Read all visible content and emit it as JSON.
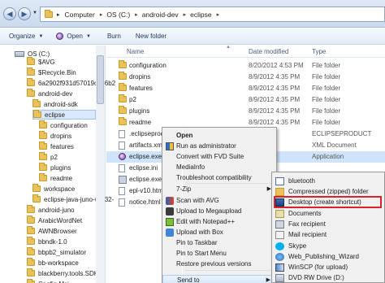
{
  "address": {
    "crumbs": [
      "Computer",
      "OS (C:)",
      "android-dev",
      "eclipse"
    ]
  },
  "toolbar": {
    "organize": "Organize",
    "open": "Open",
    "burn": "Burn",
    "new_folder": "New folder"
  },
  "columns": {
    "name": "Name",
    "date": "Date modified",
    "type": "Type"
  },
  "nav": {
    "items": [
      {
        "label": "OS (C:)",
        "kind": "drive"
      },
      {
        "label": "$AVG",
        "kind": "folder"
      },
      {
        "label": "$Recycle.Bin",
        "kind": "folder"
      },
      {
        "label": "6a2902f931d57019c886b2",
        "kind": "folder"
      },
      {
        "label": "android-dev",
        "kind": "folder"
      },
      {
        "label": "android-sdk",
        "kind": "folder"
      },
      {
        "label": "eclipse",
        "kind": "folder",
        "selected": true
      },
      {
        "label": "configuration",
        "kind": "folder"
      },
      {
        "label": "dropins",
        "kind": "folder"
      },
      {
        "label": "features",
        "kind": "folder"
      },
      {
        "label": "p2",
        "kind": "folder"
      },
      {
        "label": "plugins",
        "kind": "folder"
      },
      {
        "label": "readme",
        "kind": "folder"
      },
      {
        "label": "workspace",
        "kind": "folder"
      },
      {
        "label": "eclipse-java-juno-win32-",
        "kind": "folder"
      },
      {
        "label": "android-juno",
        "kind": "folder"
      },
      {
        "label": "ArabicWordNet",
        "kind": "folder"
      },
      {
        "label": "AWNBrowser",
        "kind": "folder"
      },
      {
        "label": "bbndk-1.0",
        "kind": "folder"
      },
      {
        "label": "bbpb2_simulator",
        "kind": "folder"
      },
      {
        "label": "bb-workspace",
        "kind": "folder"
      },
      {
        "label": "blackberry.tools.SDK",
        "kind": "folder"
      },
      {
        "label": "Config.Msi",
        "kind": "folder"
      }
    ]
  },
  "files": [
    {
      "name": "configuration",
      "date": "8/20/2012 4:53 PM",
      "type": "File folder",
      "icon": "folder"
    },
    {
      "name": "dropins",
      "date": "8/9/2012 4:35 PM",
      "type": "File folder",
      "icon": "folder"
    },
    {
      "name": "features",
      "date": "8/9/2012 4:35 PM",
      "type": "File folder",
      "icon": "folder"
    },
    {
      "name": "p2",
      "date": "8/9/2012 4:35 PM",
      "type": "File folder",
      "icon": "folder"
    },
    {
      "name": "plugins",
      "date": "8/9/2012 4:35 PM",
      "type": "File folder",
      "icon": "folder"
    },
    {
      "name": "readme",
      "date": "8/9/2012 4:35 PM",
      "type": "File folder",
      "icon": "folder"
    },
    {
      "name": ".eclipseprod",
      "date": "4:35 PM",
      "type": "ECLIPSEPRODUCT",
      "icon": "file"
    },
    {
      "name": "artifacts.xml",
      "date": "4:35 PM",
      "type": "XML Document",
      "icon": "file"
    },
    {
      "name": "eclipse.exe",
      "date": "4:35 PM",
      "type": "Application",
      "icon": "app",
      "selected": true
    },
    {
      "name": "eclipse.ini",
      "date": "",
      "type": "",
      "icon": "file"
    },
    {
      "name": "eclipse.exe",
      "date": "",
      "type": "",
      "icon": "sys"
    },
    {
      "name": "epl-v10.htm",
      "date": "",
      "type": "",
      "icon": "file"
    },
    {
      "name": "notice.html",
      "date": "",
      "type": "",
      "icon": "file"
    }
  ],
  "context_menu": {
    "items": [
      {
        "label": "Open",
        "bold": true,
        "icon": ""
      },
      {
        "label": "Run as administrator",
        "icon": "shield-icon"
      },
      {
        "label": "Convert with FVD Suite",
        "icon": ""
      },
      {
        "label": "MediaInfo",
        "icon": ""
      },
      {
        "label": "Troubleshoot compatibility",
        "icon": ""
      },
      {
        "label": "7-Zip",
        "icon": "",
        "submenu": true
      },
      {
        "label": "Scan with AVG",
        "icon": "avg-icon"
      },
      {
        "label": "Upload to Megaupload",
        "icon": "megaupload-icon"
      },
      {
        "label": "Edit with Notepad++",
        "icon": "notepad-icon"
      },
      {
        "label": "Upload with Box",
        "icon": "box-icon"
      },
      {
        "label": "Pin to Taskbar",
        "icon": ""
      },
      {
        "label": "Pin to Start Menu",
        "icon": ""
      },
      {
        "label": "Restore previous versions",
        "icon": ""
      },
      {
        "label": "Send to",
        "icon": "",
        "submenu": true
      }
    ]
  },
  "send_to": {
    "items": [
      {
        "label": "bluetooth",
        "icon": "bluetooth-icon"
      },
      {
        "label": "Compressed (zipped) folder",
        "icon": "zip-icon"
      },
      {
        "label": "Desktop (create shortcut)",
        "icon": "desktop-icon",
        "highlighted": true
      },
      {
        "label": "Documents",
        "icon": "documents-icon"
      },
      {
        "label": "Fax recipient",
        "icon": "fax-icon"
      },
      {
        "label": "Mail recipient",
        "icon": "mail-icon"
      },
      {
        "label": "Skype",
        "icon": "skype-icon"
      },
      {
        "label": "Web_Publishing_Wizard",
        "icon": "web-icon"
      },
      {
        "label": "WinSCP (for upload)",
        "icon": "winscp-icon"
      },
      {
        "label": "DVD RW Drive (D:)",
        "icon": "dvd-icon"
      }
    ],
    "highlight_color": "#d6232f"
  }
}
